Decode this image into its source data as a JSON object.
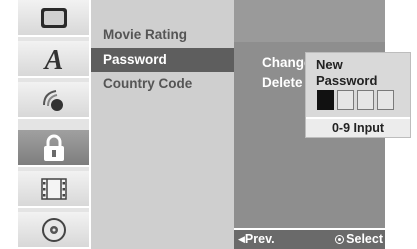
{
  "sidebar": {
    "icons": [
      {
        "name": "monitor-icon",
        "active": false
      },
      {
        "name": "language-icon",
        "glyph": "A",
        "active": false
      },
      {
        "name": "audio-icon",
        "active": false
      },
      {
        "name": "lock-icon",
        "active": true
      },
      {
        "name": "film-strip-icon",
        "active": false
      },
      {
        "name": "disc-icon",
        "active": false
      }
    ]
  },
  "menu": {
    "items": [
      {
        "label": "Movie Rating",
        "selected": false
      },
      {
        "label": "Password",
        "selected": true
      },
      {
        "label": "Country Code",
        "selected": false
      }
    ]
  },
  "options": {
    "change_label": "Change",
    "delete_label": "Delete"
  },
  "popup": {
    "title": "New Password",
    "boxes_total": 4,
    "boxes_filled": 1,
    "footer": "0-9 Input"
  },
  "bottom": {
    "prev_label": "Prev.",
    "select_label": "Select"
  },
  "colors": {
    "menu_bg": "#cfcfcf",
    "menu_selected": "#5e5e5e",
    "panel_bg": "#8e8e8e",
    "popup_bg": "#d9d9d9"
  }
}
